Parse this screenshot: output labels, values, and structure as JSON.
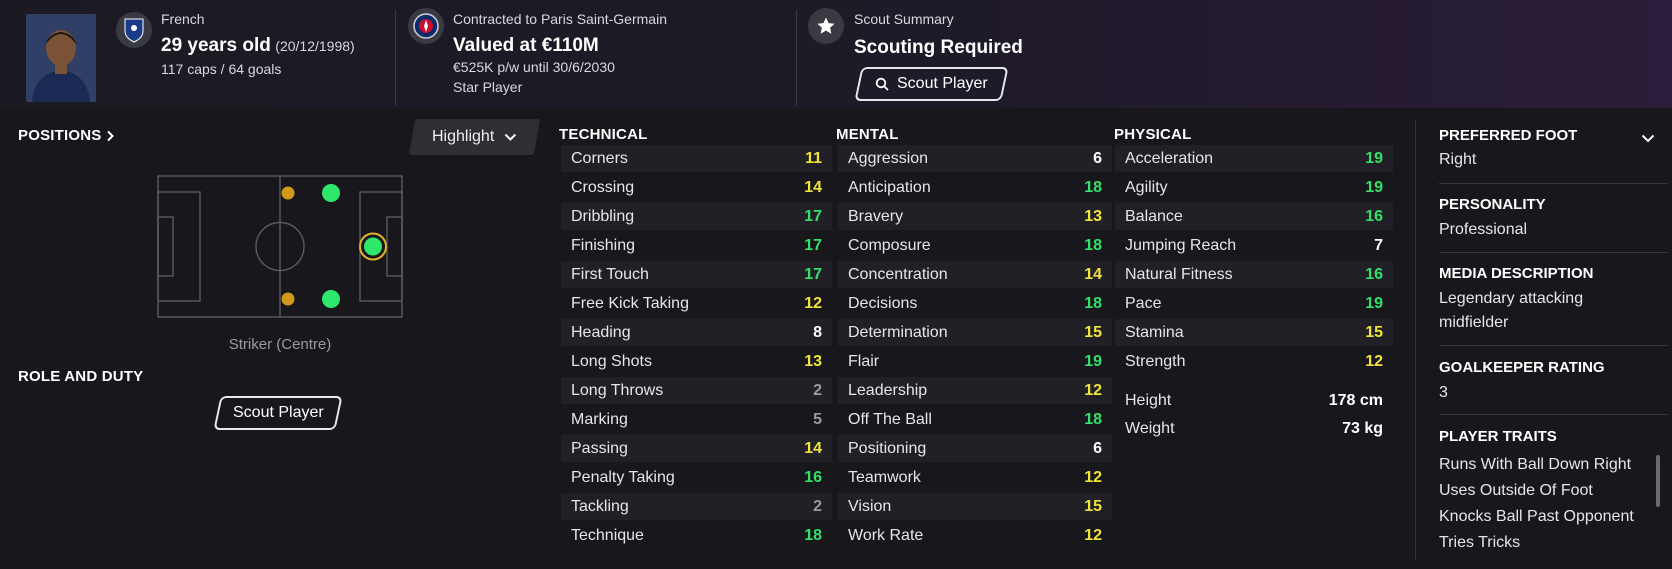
{
  "header": {
    "nationality": "French",
    "age": "29 years old",
    "dob": "(20/12/1998)",
    "caps_goals": "117 caps / 64 goals",
    "contract": "Contracted to Paris Saint-Germain",
    "value": "Valued at €110M",
    "wage": "€525K p/w until 30/6/2030",
    "status": "Star Player",
    "scout_summary_label": "Scout Summary",
    "scout_summary_value": "Scouting Required",
    "scout_button": "Scout Player"
  },
  "left": {
    "positions_label": "POSITIONS",
    "highlight_label": "Highlight",
    "position_caption": "Striker (Centre)",
    "role_label": "ROLE AND DUTY",
    "scout_button": "Scout Player"
  },
  "technical": {
    "title": "TECHNICAL",
    "items": [
      {
        "name": "Corners",
        "value": "11",
        "color": "#f0e33c"
      },
      {
        "name": "Crossing",
        "value": "14",
        "color": "#f0e33c"
      },
      {
        "name": "Dribbling",
        "value": "17",
        "color": "#34e06a"
      },
      {
        "name": "Finishing",
        "value": "17",
        "color": "#34e06a"
      },
      {
        "name": "First Touch",
        "value": "17",
        "color": "#34e06a"
      },
      {
        "name": "Free Kick Taking",
        "value": "12",
        "color": "#f0e33c"
      },
      {
        "name": "Heading",
        "value": "8",
        "color": "#ffffff"
      },
      {
        "name": "Long Shots",
        "value": "13",
        "color": "#f0e33c"
      },
      {
        "name": "Long Throws",
        "value": "2",
        "color": "#9a9aa2"
      },
      {
        "name": "Marking",
        "value": "5",
        "color": "#9a9aa2"
      },
      {
        "name": "Passing",
        "value": "14",
        "color": "#f0e33c"
      },
      {
        "name": "Penalty Taking",
        "value": "16",
        "color": "#34e06a"
      },
      {
        "name": "Tackling",
        "value": "2",
        "color": "#9a9aa2"
      },
      {
        "name": "Technique",
        "value": "18",
        "color": "#34e06a"
      }
    ]
  },
  "mental": {
    "title": "MENTAL",
    "items": [
      {
        "name": "Aggression",
        "value": "6",
        "color": "#ffffff"
      },
      {
        "name": "Anticipation",
        "value": "18",
        "color": "#34e06a"
      },
      {
        "name": "Bravery",
        "value": "13",
        "color": "#f0e33c"
      },
      {
        "name": "Composure",
        "value": "18",
        "color": "#34e06a"
      },
      {
        "name": "Concentration",
        "value": "14",
        "color": "#f0e33c"
      },
      {
        "name": "Decisions",
        "value": "18",
        "color": "#34e06a"
      },
      {
        "name": "Determination",
        "value": "15",
        "color": "#f0e33c"
      },
      {
        "name": "Flair",
        "value": "19",
        "color": "#34e06a"
      },
      {
        "name": "Leadership",
        "value": "12",
        "color": "#f0e33c"
      },
      {
        "name": "Off The Ball",
        "value": "18",
        "color": "#34e06a"
      },
      {
        "name": "Positioning",
        "value": "6",
        "color": "#ffffff"
      },
      {
        "name": "Teamwork",
        "value": "12",
        "color": "#f0e33c"
      },
      {
        "name": "Vision",
        "value": "15",
        "color": "#f0e33c"
      },
      {
        "name": "Work Rate",
        "value": "12",
        "color": "#f0e33c"
      }
    ]
  },
  "physical": {
    "title": "PHYSICAL",
    "items": [
      {
        "name": "Acceleration",
        "value": "19",
        "color": "#34e06a"
      },
      {
        "name": "Agility",
        "value": "19",
        "color": "#34e06a"
      },
      {
        "name": "Balance",
        "value": "16",
        "color": "#34e06a"
      },
      {
        "name": "Jumping Reach",
        "value": "7",
        "color": "#ffffff"
      },
      {
        "name": "Natural Fitness",
        "value": "16",
        "color": "#34e06a"
      },
      {
        "name": "Pace",
        "value": "19",
        "color": "#34e06a"
      },
      {
        "name": "Stamina",
        "value": "15",
        "color": "#f0e33c"
      },
      {
        "name": "Strength",
        "value": "12",
        "color": "#f0e33c"
      }
    ],
    "height_label": "Height",
    "height_value": "178 cm",
    "weight_label": "Weight",
    "weight_value": "73 kg"
  },
  "right": {
    "foot_label": "PREFERRED FOOT",
    "foot_value": "Right",
    "personality_label": "PERSONALITY",
    "personality_value": "Professional",
    "media_label": "MEDIA DESCRIPTION",
    "media_line1": "Legendary attacking",
    "media_line2": "midfielder",
    "gk_label": "GOALKEEPER RATING",
    "gk_value": "3",
    "traits_label": "PLAYER TRAITS",
    "traits": [
      "Runs With Ball Down Right",
      "Uses Outside Of Foot",
      "Knocks Ball Past Opponent",
      "Tries Tricks"
    ]
  }
}
